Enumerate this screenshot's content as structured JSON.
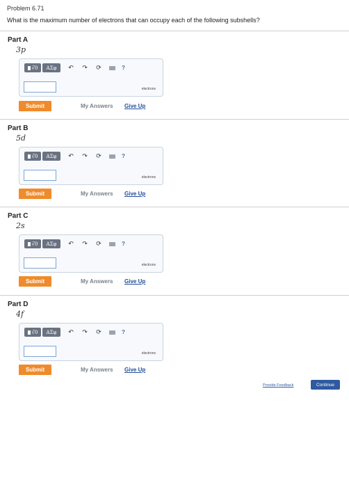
{
  "problem": {
    "title": "Problem 6.71",
    "question": "What is the maximum number of electrons that can occupy each of the following subshells?"
  },
  "toolbar": {
    "templates_label": "√̃0",
    "greek_label": "AΣφ",
    "undo_icon": "undo-icon",
    "redo_icon": "redo-icon",
    "reset_icon": "reset-icon",
    "keyboard_icon": "keyboard-icon",
    "help_label": "?"
  },
  "parts": [
    {
      "label": "Part A",
      "subshell": "3p",
      "input_value": "",
      "units": "electrons",
      "submit_label": "Submit",
      "my_answers_label": "My Answers",
      "give_up_label": "Give Up"
    },
    {
      "label": "Part B",
      "subshell": "5d",
      "input_value": "",
      "units": "electrons",
      "submit_label": "Submit",
      "my_answers_label": "My Answers",
      "give_up_label": "Give Up"
    },
    {
      "label": "Part C",
      "subshell": "2s",
      "input_value": "",
      "units": "electrons",
      "submit_label": "Submit",
      "my_answers_label": "My Answers",
      "give_up_label": "Give Up"
    },
    {
      "label": "Part D",
      "subshell": "4f",
      "input_value": "",
      "units": "electrons",
      "submit_label": "Submit",
      "my_answers_label": "My Answers",
      "give_up_label": "Give Up"
    }
  ],
  "footer": {
    "feedback_label": "Provide Feedback",
    "continue_label": "Continue"
  },
  "colors": {
    "submit": "#ef8b2c",
    "link": "#1f4d9b",
    "continue": "#2f5aa0",
    "toolbar_button": "#6a7280"
  }
}
